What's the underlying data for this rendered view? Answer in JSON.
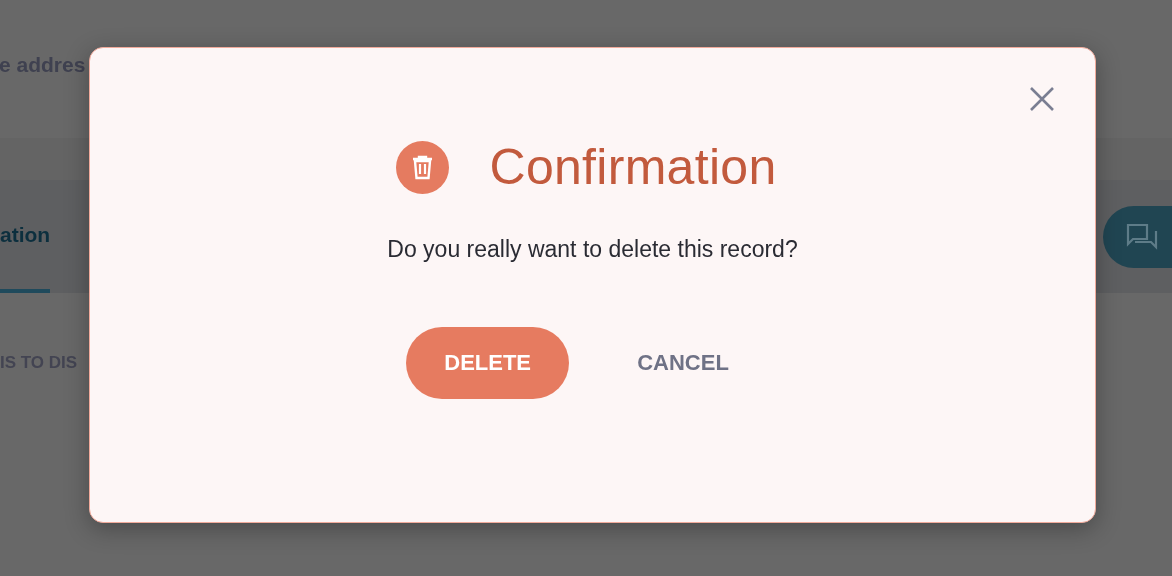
{
  "background_page": {
    "header_text": "e addres",
    "tabs": [
      {
        "label": "ation",
        "selected": true
      }
    ],
    "section_heading": "IS TO DIS"
  },
  "dialog": {
    "title": "Confirmation",
    "message": "Do you really want to delete this record?",
    "buttons": [
      {
        "label": "DELETE",
        "kind": "primary"
      },
      {
        "label": "CANCEL",
        "kind": "text"
      }
    ]
  }
}
